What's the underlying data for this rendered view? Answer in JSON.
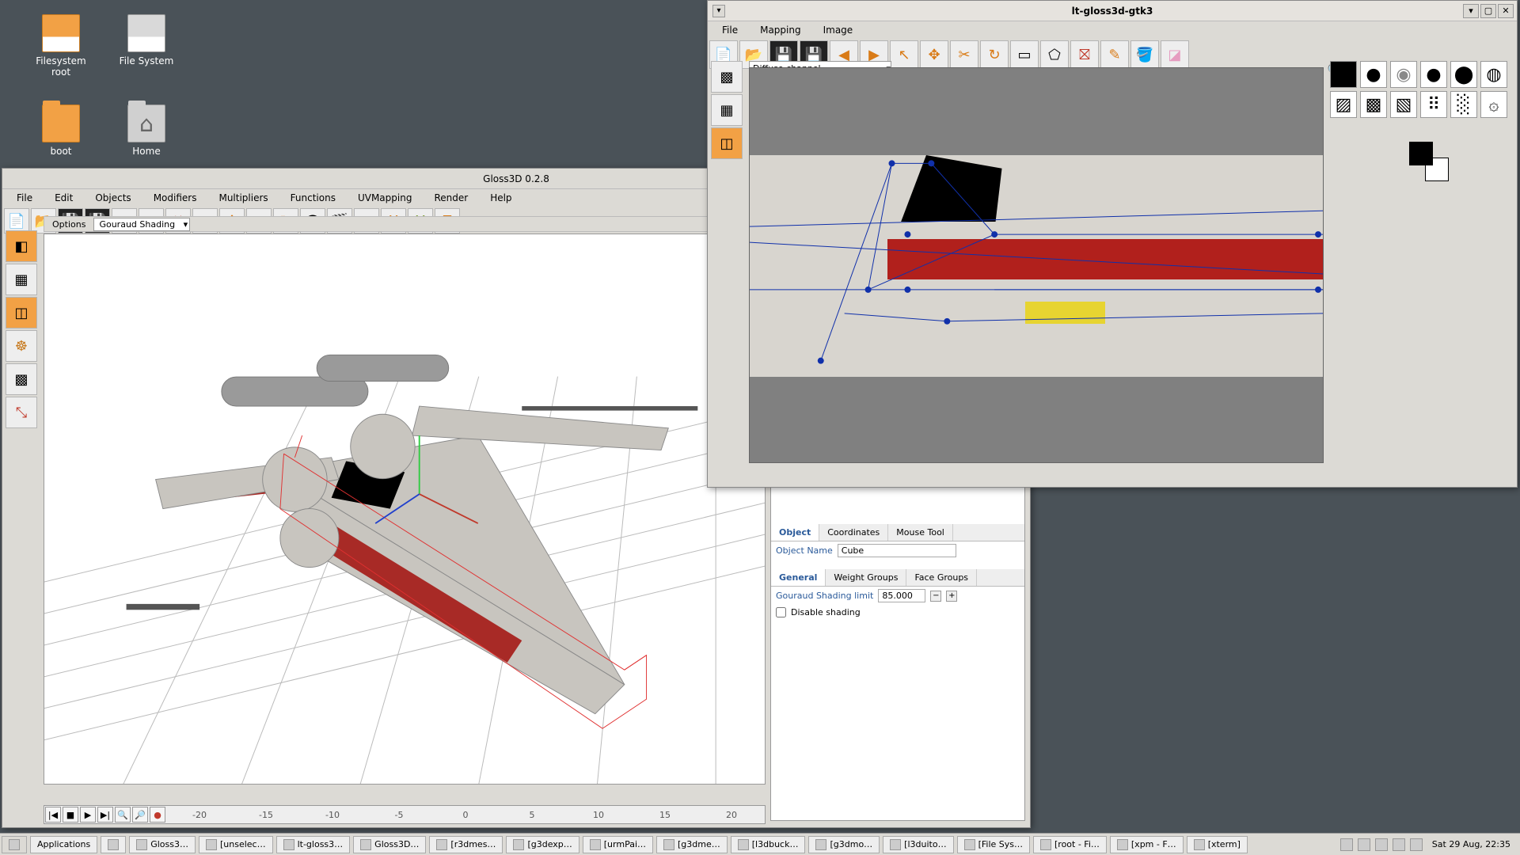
{
  "desktop": {
    "icons": [
      {
        "label": "Filesystem root"
      },
      {
        "label": "File System"
      },
      {
        "label": "boot"
      },
      {
        "label": "Home"
      }
    ]
  },
  "gloss3d": {
    "title": "Gloss3D 0.2.8",
    "menu": [
      "File",
      "Edit",
      "Objects",
      "Modifiers",
      "Multipliers",
      "Functions",
      "UVMapping",
      "Render",
      "Help"
    ],
    "options_label": "Options",
    "shading_select": "Gouraud Shading",
    "timeline": {
      "ticks": [
        "-20",
        "-15",
        "-10",
        "-5",
        "0",
        "5",
        "10",
        "15",
        "20"
      ]
    },
    "props": {
      "tabs1": [
        "Object",
        "Coordinates",
        "Mouse Tool"
      ],
      "object_name_label": "Object Name",
      "object_name": "Cube",
      "tabs2": [
        "General",
        "Weight Groups",
        "Face Groups"
      ],
      "gouraud_label": "Gouraud Shading limit",
      "gouraud_value": "85.000",
      "disable_shading": "Disable shading"
    },
    "toolbar_icons": [
      "new-file",
      "open-file",
      "save",
      "save-as",
      "undo",
      "redo",
      "delete",
      "pointer",
      "move",
      "scale",
      "rotate",
      "view",
      "render",
      "material-sphere",
      "axis-x",
      "axis-y",
      "axis-z"
    ],
    "side_icons": [
      "object-mode",
      "mesh-grid",
      "face-select",
      "armature",
      "uv-checker",
      "axes"
    ]
  },
  "uvwin": {
    "title": "lt-gloss3d-gtk3",
    "menu": [
      "File",
      "Mapping",
      "Image"
    ],
    "channel": "Diffuse channel",
    "toolbar_icons": [
      "new-file",
      "open-file",
      "save",
      "save-as",
      "undo",
      "redo",
      "pointer",
      "move",
      "scale",
      "rotate",
      "rect-select",
      "lasso",
      "erase-rect",
      "pencil",
      "bucket",
      "eraser"
    ],
    "side_icons": [
      "checker-tool",
      "uv-stretch",
      "color-tool"
    ],
    "brush_icons": [
      "square",
      "round-hard",
      "round-soft",
      "round-mid",
      "round-dark",
      "ring",
      "hatch-1",
      "hatch-2",
      "hatch-3",
      "dots",
      "noise",
      "swirl"
    ]
  },
  "taskbar": {
    "start": "Applications",
    "items": [
      "Gloss3…",
      "[unselec…",
      "lt-gloss3…",
      "Gloss3D…",
      "[r3dmes…",
      "[g3dexp…",
      "[urmPai…",
      "[g3dme…",
      "[l3dbuck…",
      "[g3dmo…",
      "[l3duito…",
      "[File Sys…",
      "[root - Fi…",
      "[xpm - F…",
      "[xterm]"
    ],
    "clock": "Sat 29 Aug, 22:35"
  }
}
